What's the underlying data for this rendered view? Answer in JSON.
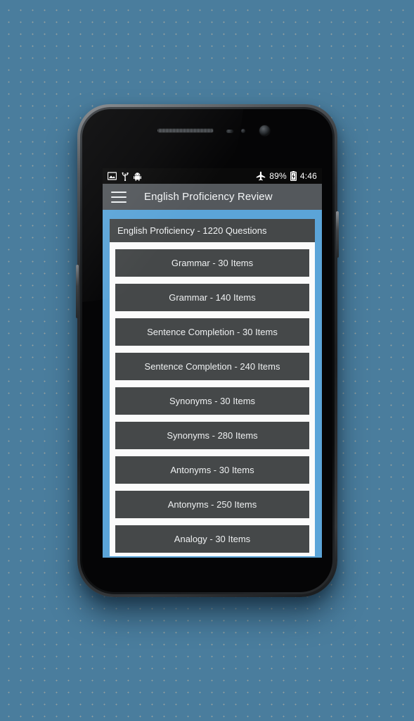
{
  "status_bar": {
    "left_icons": [
      "image-icon",
      "usb-icon",
      "android-debug-icon"
    ],
    "airplane_icon": "airplane-mode-icon",
    "battery_percent": "89%",
    "battery_icon": "battery-charging-icon",
    "time": "4:46"
  },
  "app_bar": {
    "menu_icon": "hamburger-menu-icon",
    "title": "English Proficiency Review"
  },
  "content": {
    "section_header": "English Proficiency - 1220 Questions",
    "items": [
      {
        "label": "Grammar - 30 Items"
      },
      {
        "label": "Grammar - 140 Items"
      },
      {
        "label": "Sentence Completion - 30 Items"
      },
      {
        "label": "Sentence Completion - 240 Items"
      },
      {
        "label": "Synonyms - 30 Items"
      },
      {
        "label": "Synonyms - 280 Items"
      },
      {
        "label": "Antonyms - 30 Items"
      },
      {
        "label": "Antonyms - 250 Items"
      },
      {
        "label": "Analogy - 30 Items"
      }
    ]
  },
  "colors": {
    "desktop_background": "#4a7d9d",
    "accent_blue": "#5ba4d8",
    "app_bar": "#54585c",
    "item_background": "#454849",
    "item_text": "#eef0f1",
    "panel_background": "#fbfbfb",
    "status_bar": "#0a0a0a"
  }
}
